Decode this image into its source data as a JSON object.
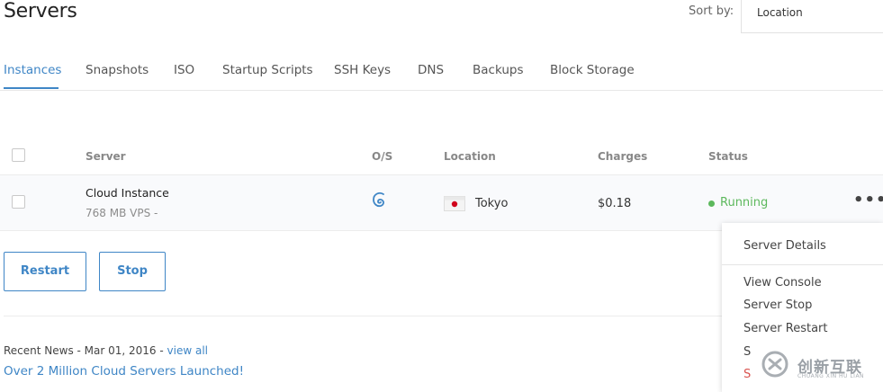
{
  "header": {
    "title": "Servers",
    "sort_label": "Sort by:",
    "sort_value": "Location"
  },
  "tabs": [
    {
      "label": "Instances",
      "active": true
    },
    {
      "label": "Snapshots"
    },
    {
      "label": "ISO"
    },
    {
      "label": "Startup Scripts"
    },
    {
      "label": "SSH Keys"
    },
    {
      "label": "DNS"
    },
    {
      "label": "Backups"
    },
    {
      "label": "Block Storage"
    }
  ],
  "table": {
    "columns": [
      "Server",
      "O/S",
      "Location",
      "Charges",
      "Status"
    ],
    "rows": [
      {
        "name": "Cloud Instance",
        "plan": "768 MB VPS -",
        "os_icon": "debian-icon",
        "location_flag": "japan-flag-icon",
        "location": "Tokyo",
        "charges": "$0.18",
        "status": "Running",
        "status_color": "#5cb85c"
      }
    ]
  },
  "actions": {
    "restart": "Restart",
    "stop": "Stop"
  },
  "news": {
    "prefix": "Recent News - Mar 01, 2016 -",
    "view_all": "view all",
    "headline": "Over 2 Million Cloud Servers Launched!"
  },
  "menu": {
    "items": [
      {
        "label": "Server Details"
      },
      {
        "label": "View Console"
      },
      {
        "label": "Server Stop"
      },
      {
        "label": "Server Restart"
      },
      {
        "label": "S"
      },
      {
        "label": "S",
        "danger": true
      }
    ]
  },
  "watermark": {
    "text": "创新互联",
    "sub": "CHUANG XIN HU LIAN"
  },
  "colors": {
    "accent": "#3f86c6",
    "running": "#5cb85c",
    "danger": "#d9534f"
  }
}
